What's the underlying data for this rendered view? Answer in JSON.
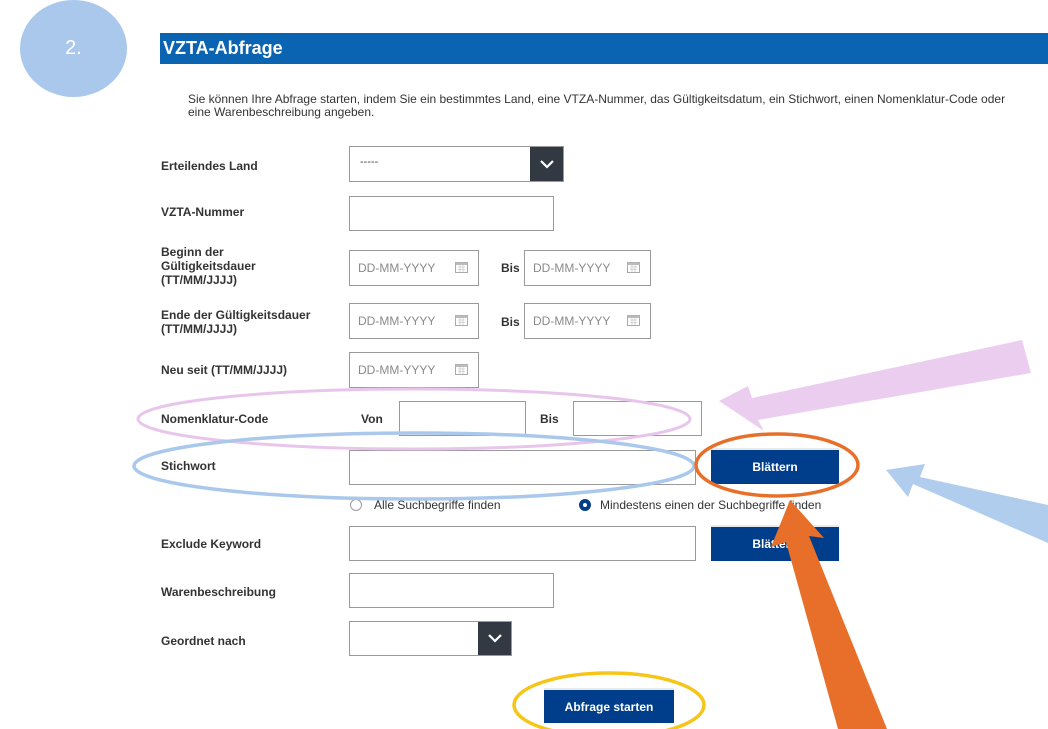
{
  "step": {
    "label": "2."
  },
  "header": {
    "title": "VZTA-Abfrage"
  },
  "intro": "Sie können Ihre Abfrage starten, indem Sie ein bestimmtes Land, eine VTZA-Nummer, das Gültigkeitsdatum, ein Stichwort, einen Nomenklatur-Code oder eine Warenbeschreibung angeben.",
  "form": {
    "country": {
      "label": "Erteilendes Land",
      "value": "-----"
    },
    "number": {
      "label": "VZTA-Nummer",
      "value": ""
    },
    "start": {
      "label_lines": [
        "Beginn der",
        "Gültigkeitsdauer",
        "(TT/MM/JJJJ)"
      ],
      "from_placeholder": "DD-MM-YYYY",
      "to_label": "Bis",
      "to_placeholder": "DD-MM-YYYY"
    },
    "end": {
      "label_lines": [
        "Ende der Gültigkeitsdauer",
        "(TT/MM/JJJJ)"
      ],
      "from_placeholder": "DD-MM-YYYY",
      "to_label": "Bis",
      "to_placeholder": "DD-MM-YYYY"
    },
    "new_since": {
      "label": "Neu seit (TT/MM/JJJJ)",
      "placeholder": "DD-MM-YYYY"
    },
    "nomenclature": {
      "label": "Nomenklatur-Code",
      "from_label": "Von",
      "to_label": "Bis"
    },
    "keyword": {
      "label": "Stichwort",
      "button": "Blättern",
      "options": [
        {
          "label": "Alle Suchbegriffe finden",
          "selected": false
        },
        {
          "label": "Mindestens einen der Suchbegriffe finden",
          "selected": true
        }
      ]
    },
    "exclude_keyword": {
      "label": "Exclude Keyword",
      "button": "Blättern"
    },
    "description": {
      "label": "Warenbeschreibung"
    },
    "order_by": {
      "label": "Geordnet nach",
      "value": ""
    },
    "submit": "Abfrage starten"
  },
  "colors": {
    "header": "#0a64b2",
    "button": "#003e8c",
    "step_circle": "#a9c8ec",
    "highlight_pink": "#e8c6ec",
    "highlight_blue": "#a9c8ec",
    "highlight_orange": "#e86f2a",
    "highlight_yellow": "#f5c518"
  }
}
